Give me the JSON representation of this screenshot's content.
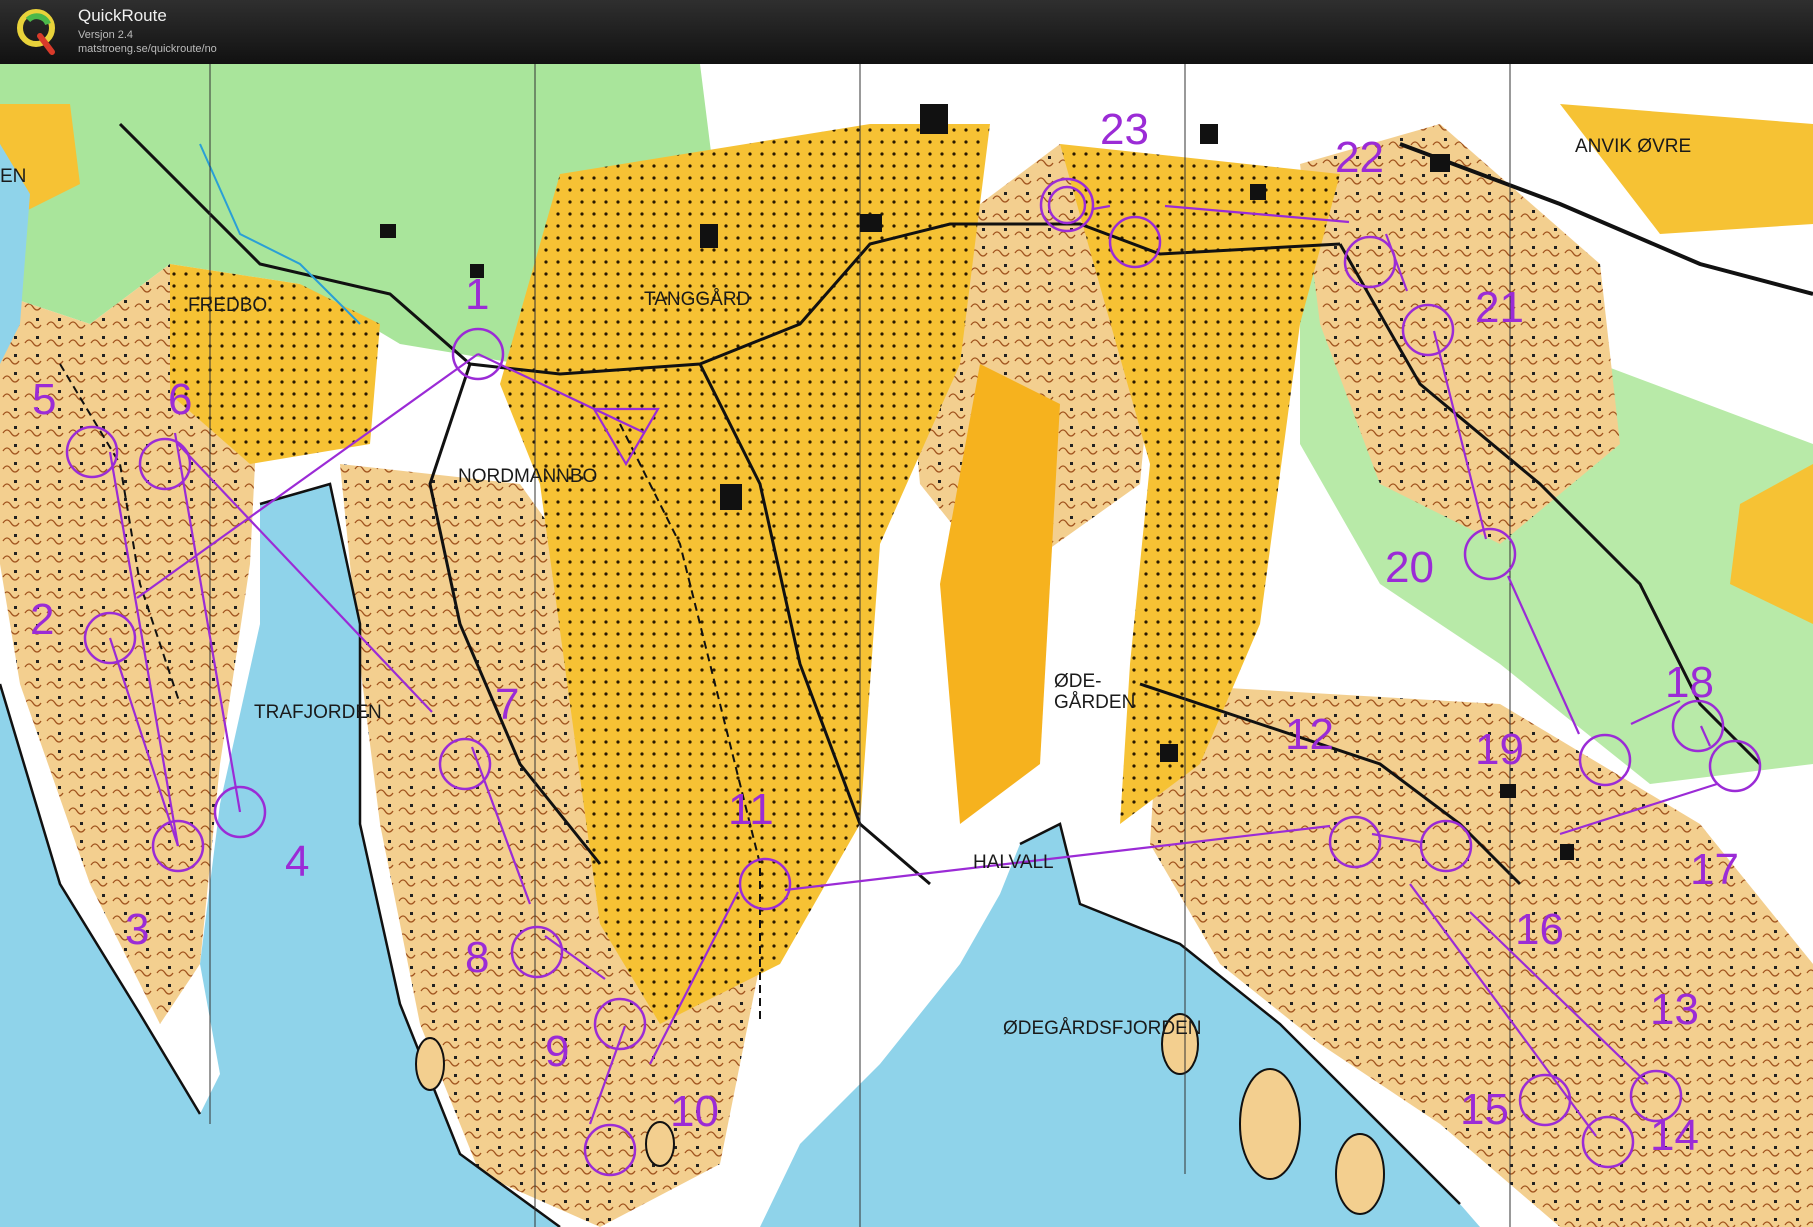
{
  "app": {
    "name": "QuickRoute",
    "version": "Versjon 2.4",
    "url": "matstroeng.se/quickroute/no"
  },
  "colors": {
    "water": "#8fd3ea",
    "open": "#f6c234",
    "forest": "#ffffff",
    "green": "#a9e59b",
    "rock": "#f3cf8f",
    "course": "#9b2bd6"
  },
  "map": {
    "place_names": [
      "FREDBO",
      "TANGGÅRD",
      "NORDMANNBO",
      "TRAFJORDEN",
      "ANVIK ØVRE",
      "ØDE-",
      "GÅRDEN",
      "HALVALL",
      "ØDEGÅRDSFJORDEN",
      "EN"
    ],
    "controls": [
      {
        "label": "1"
      },
      {
        "label": "2"
      },
      {
        "label": "3"
      },
      {
        "label": "4"
      },
      {
        "label": "5"
      },
      {
        "label": "6"
      },
      {
        "label": "7"
      },
      {
        "label": "8"
      },
      {
        "label": "9"
      },
      {
        "label": "10"
      },
      {
        "label": "11"
      },
      {
        "label": "12"
      },
      {
        "label": "13"
      },
      {
        "label": "14"
      },
      {
        "label": "15"
      },
      {
        "label": "16"
      },
      {
        "label": "17"
      },
      {
        "label": "18"
      },
      {
        "label": "19"
      },
      {
        "label": "20"
      },
      {
        "label": "21"
      },
      {
        "label": "22"
      },
      {
        "label": "23"
      }
    ]
  }
}
